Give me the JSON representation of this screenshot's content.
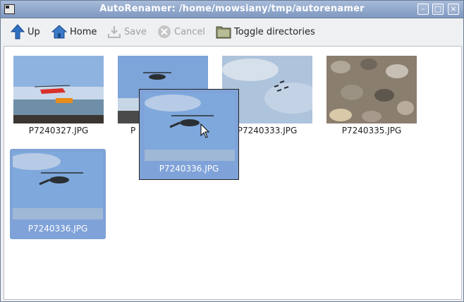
{
  "window": {
    "title": "AutoRenamer: /home/mowsiany/tmp/autorenamer"
  },
  "toolbar": {
    "up": "Up",
    "home": "Home",
    "save": "Save",
    "cancel": "Cancel",
    "toggle": "Toggle directories"
  },
  "files": [
    {
      "name": "P7240327.JPG",
      "icon": "image-file"
    },
    {
      "name": "P",
      "icon": "image-file"
    },
    {
      "name": "P7240333.JPG",
      "icon": "image-file"
    },
    {
      "name": "P7240335.JPG",
      "icon": "image-file"
    },
    {
      "name": "P7240336.JPG",
      "icon": "image-file",
      "selected": true
    }
  ],
  "drag": {
    "name": "P7240336.JPG"
  },
  "colors": {
    "selection": "#7fa2d8",
    "titlebar": "#8fa6cb"
  }
}
